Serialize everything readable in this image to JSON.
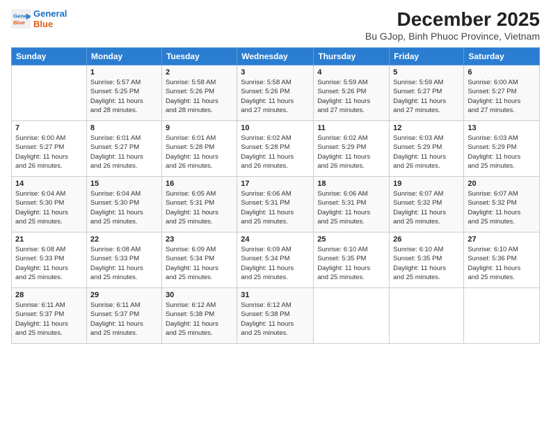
{
  "logo": {
    "line1": "General",
    "line2": "Blue"
  },
  "title": "December 2025",
  "subtitle": "Bu GJop, Binh Phuoc Province, Vietnam",
  "header_colors": {
    "bg": "#2a7dd1"
  },
  "days_of_week": [
    "Sunday",
    "Monday",
    "Tuesday",
    "Wednesday",
    "Thursday",
    "Friday",
    "Saturday"
  ],
  "weeks": [
    [
      {
        "num": "",
        "info": ""
      },
      {
        "num": "1",
        "info": "Sunrise: 5:57 AM\nSunset: 5:25 PM\nDaylight: 11 hours\nand 28 minutes."
      },
      {
        "num": "2",
        "info": "Sunrise: 5:58 AM\nSunset: 5:26 PM\nDaylight: 11 hours\nand 28 minutes."
      },
      {
        "num": "3",
        "info": "Sunrise: 5:58 AM\nSunset: 5:26 PM\nDaylight: 11 hours\nand 27 minutes."
      },
      {
        "num": "4",
        "info": "Sunrise: 5:59 AM\nSunset: 5:26 PM\nDaylight: 11 hours\nand 27 minutes."
      },
      {
        "num": "5",
        "info": "Sunrise: 5:59 AM\nSunset: 5:27 PM\nDaylight: 11 hours\nand 27 minutes."
      },
      {
        "num": "6",
        "info": "Sunrise: 6:00 AM\nSunset: 5:27 PM\nDaylight: 11 hours\nand 27 minutes."
      }
    ],
    [
      {
        "num": "7",
        "info": "Sunrise: 6:00 AM\nSunset: 5:27 PM\nDaylight: 11 hours\nand 26 minutes."
      },
      {
        "num": "8",
        "info": "Sunrise: 6:01 AM\nSunset: 5:27 PM\nDaylight: 11 hours\nand 26 minutes."
      },
      {
        "num": "9",
        "info": "Sunrise: 6:01 AM\nSunset: 5:28 PM\nDaylight: 11 hours\nand 26 minutes."
      },
      {
        "num": "10",
        "info": "Sunrise: 6:02 AM\nSunset: 5:28 PM\nDaylight: 11 hours\nand 26 minutes."
      },
      {
        "num": "11",
        "info": "Sunrise: 6:02 AM\nSunset: 5:29 PM\nDaylight: 11 hours\nand 26 minutes."
      },
      {
        "num": "12",
        "info": "Sunrise: 6:03 AM\nSunset: 5:29 PM\nDaylight: 11 hours\nand 26 minutes."
      },
      {
        "num": "13",
        "info": "Sunrise: 6:03 AM\nSunset: 5:29 PM\nDaylight: 11 hours\nand 25 minutes."
      }
    ],
    [
      {
        "num": "14",
        "info": "Sunrise: 6:04 AM\nSunset: 5:30 PM\nDaylight: 11 hours\nand 25 minutes."
      },
      {
        "num": "15",
        "info": "Sunrise: 6:04 AM\nSunset: 5:30 PM\nDaylight: 11 hours\nand 25 minutes."
      },
      {
        "num": "16",
        "info": "Sunrise: 6:05 AM\nSunset: 5:31 PM\nDaylight: 11 hours\nand 25 minutes."
      },
      {
        "num": "17",
        "info": "Sunrise: 6:06 AM\nSunset: 5:31 PM\nDaylight: 11 hours\nand 25 minutes."
      },
      {
        "num": "18",
        "info": "Sunrise: 6:06 AM\nSunset: 5:31 PM\nDaylight: 11 hours\nand 25 minutes."
      },
      {
        "num": "19",
        "info": "Sunrise: 6:07 AM\nSunset: 5:32 PM\nDaylight: 11 hours\nand 25 minutes."
      },
      {
        "num": "20",
        "info": "Sunrise: 6:07 AM\nSunset: 5:32 PM\nDaylight: 11 hours\nand 25 minutes."
      }
    ],
    [
      {
        "num": "21",
        "info": "Sunrise: 6:08 AM\nSunset: 5:33 PM\nDaylight: 11 hours\nand 25 minutes."
      },
      {
        "num": "22",
        "info": "Sunrise: 6:08 AM\nSunset: 5:33 PM\nDaylight: 11 hours\nand 25 minutes."
      },
      {
        "num": "23",
        "info": "Sunrise: 6:09 AM\nSunset: 5:34 PM\nDaylight: 11 hours\nand 25 minutes."
      },
      {
        "num": "24",
        "info": "Sunrise: 6:09 AM\nSunset: 5:34 PM\nDaylight: 11 hours\nand 25 minutes."
      },
      {
        "num": "25",
        "info": "Sunrise: 6:10 AM\nSunset: 5:35 PM\nDaylight: 11 hours\nand 25 minutes."
      },
      {
        "num": "26",
        "info": "Sunrise: 6:10 AM\nSunset: 5:35 PM\nDaylight: 11 hours\nand 25 minutes."
      },
      {
        "num": "27",
        "info": "Sunrise: 6:10 AM\nSunset: 5:36 PM\nDaylight: 11 hours\nand 25 minutes."
      }
    ],
    [
      {
        "num": "28",
        "info": "Sunrise: 6:11 AM\nSunset: 5:37 PM\nDaylight: 11 hours\nand 25 minutes."
      },
      {
        "num": "29",
        "info": "Sunrise: 6:11 AM\nSunset: 5:37 PM\nDaylight: 11 hours\nand 25 minutes."
      },
      {
        "num": "30",
        "info": "Sunrise: 6:12 AM\nSunset: 5:38 PM\nDaylight: 11 hours\nand 25 minutes."
      },
      {
        "num": "31",
        "info": "Sunrise: 6:12 AM\nSunset: 5:38 PM\nDaylight: 11 hours\nand 25 minutes."
      },
      {
        "num": "",
        "info": ""
      },
      {
        "num": "",
        "info": ""
      },
      {
        "num": "",
        "info": ""
      }
    ]
  ]
}
